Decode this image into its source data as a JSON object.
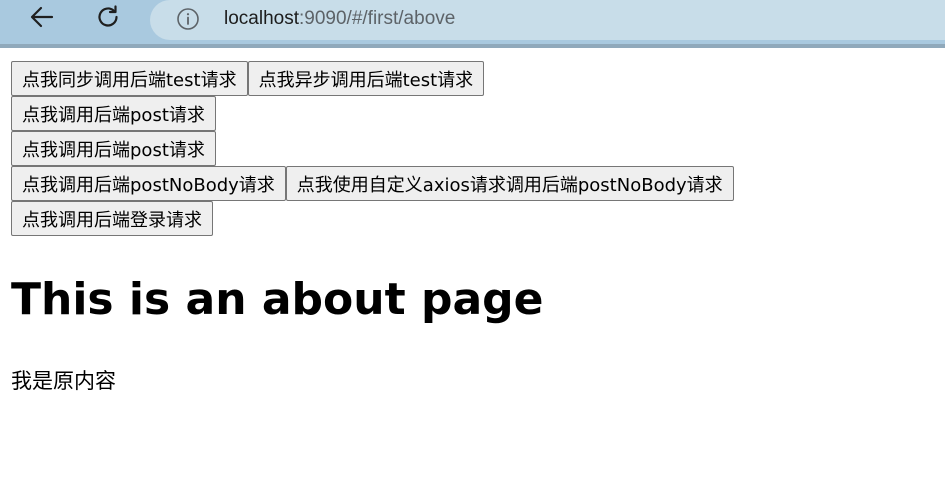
{
  "browser": {
    "url_host": "localhost",
    "url_rest": ":9090/#/first/above",
    "icons": {
      "back": "arrow-left-icon",
      "reload": "reload-icon",
      "site_info": "info-icon"
    },
    "colors": {
      "toolbar": "#a9c9df",
      "address_bar": "#c8dde9"
    }
  },
  "buttons": {
    "sync_test": "点我同步调用后端test请求",
    "async_test": "点我异步调用后端test请求",
    "post_1": "点我调用后端post请求",
    "post_2": "点我调用后端post请求",
    "post_no_body": "点我调用后端postNoBody请求",
    "axios_post_no_body": "点我使用自定义axios请求调用后端postNoBody请求",
    "login": "点我调用后端登录请求"
  },
  "page": {
    "title": "This is an about page",
    "text": "我是原内容"
  }
}
